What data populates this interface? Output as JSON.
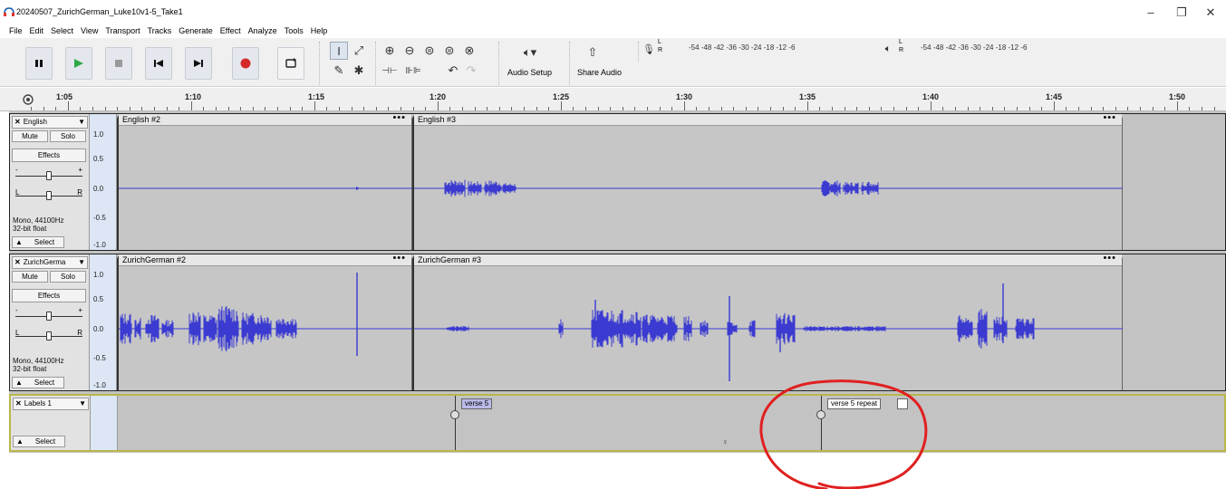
{
  "window": {
    "title": "20240507_ZurichGerman_Luke10v1-5_Take1",
    "minimize": "–",
    "maximize": "❐",
    "close": "✕"
  },
  "menu": [
    "File",
    "Edit",
    "Select",
    "View",
    "Transport",
    "Tracks",
    "Generate",
    "Effect",
    "Analyze",
    "Tools",
    "Help"
  ],
  "toolbar": {
    "audio_setup_label": "Audio Setup",
    "share_audio_label": "Share Audio",
    "record_meter_scale": "-54  -48  -42  -36  -30  -24  -18  -12   -6",
    "play_meter_scale": "-54  -48  -42  -36  -30  -24  -18  -12   -6",
    "meter_l": "L",
    "meter_r": "R"
  },
  "ruler": {
    "labels": [
      "1:05",
      "1:10",
      "1:15",
      "1:20",
      "1:25",
      "1:30",
      "1:35",
      "1:40",
      "1:45",
      "1:50"
    ]
  },
  "tracks": [
    {
      "name": "English",
      "mute": "Mute",
      "solo": "Solo",
      "effects": "Effects",
      "gain_minus": "-",
      "gain_plus": "+",
      "pan_left": "L",
      "pan_right": "R",
      "info_rate": "Mono, 44100Hz",
      "info_format": "32-bit float",
      "select": "Select",
      "scale": [
        "1.0",
        "0.5",
        "0.0",
        "-0.5",
        "-1.0"
      ],
      "clips": [
        {
          "name": "English #2",
          "menu": "•••"
        },
        {
          "name": "English #3",
          "menu": "•••"
        }
      ]
    },
    {
      "name": "ZurichGerma",
      "mute": "Mute",
      "solo": "Solo",
      "effects": "Effects",
      "gain_minus": "-",
      "gain_plus": "+",
      "pan_left": "L",
      "pan_right": "R",
      "info_rate": "Mono, 44100Hz",
      "info_format": "32-bit float",
      "select": "Select",
      "scale": [
        "1.0",
        "0.5",
        "0.0",
        "-0.5",
        "-1.0"
      ],
      "clips": [
        {
          "name": "ZurichGerman #2",
          "menu": "•••"
        },
        {
          "name": "ZurichGerman #3",
          "menu": "•••"
        }
      ]
    }
  ],
  "label_track": {
    "name": "Labels 1",
    "select": "Select",
    "labels": [
      {
        "text": "verse 5"
      },
      {
        "text": "verse 5 repeat"
      }
    ]
  },
  "colors": {
    "waveform": "#3b3bd1",
    "annotation": "#e02020",
    "label_track_border": "#b8b84a",
    "record": "#d42a2a",
    "play": "#2fa84a"
  },
  "icons": {
    "pause": "pause-icon",
    "play": "play-icon",
    "stop": "stop-icon",
    "skip_start": "skip-to-start-icon",
    "skip_end": "skip-to-end-icon",
    "record": "record-icon",
    "loop": "loop-icon"
  }
}
